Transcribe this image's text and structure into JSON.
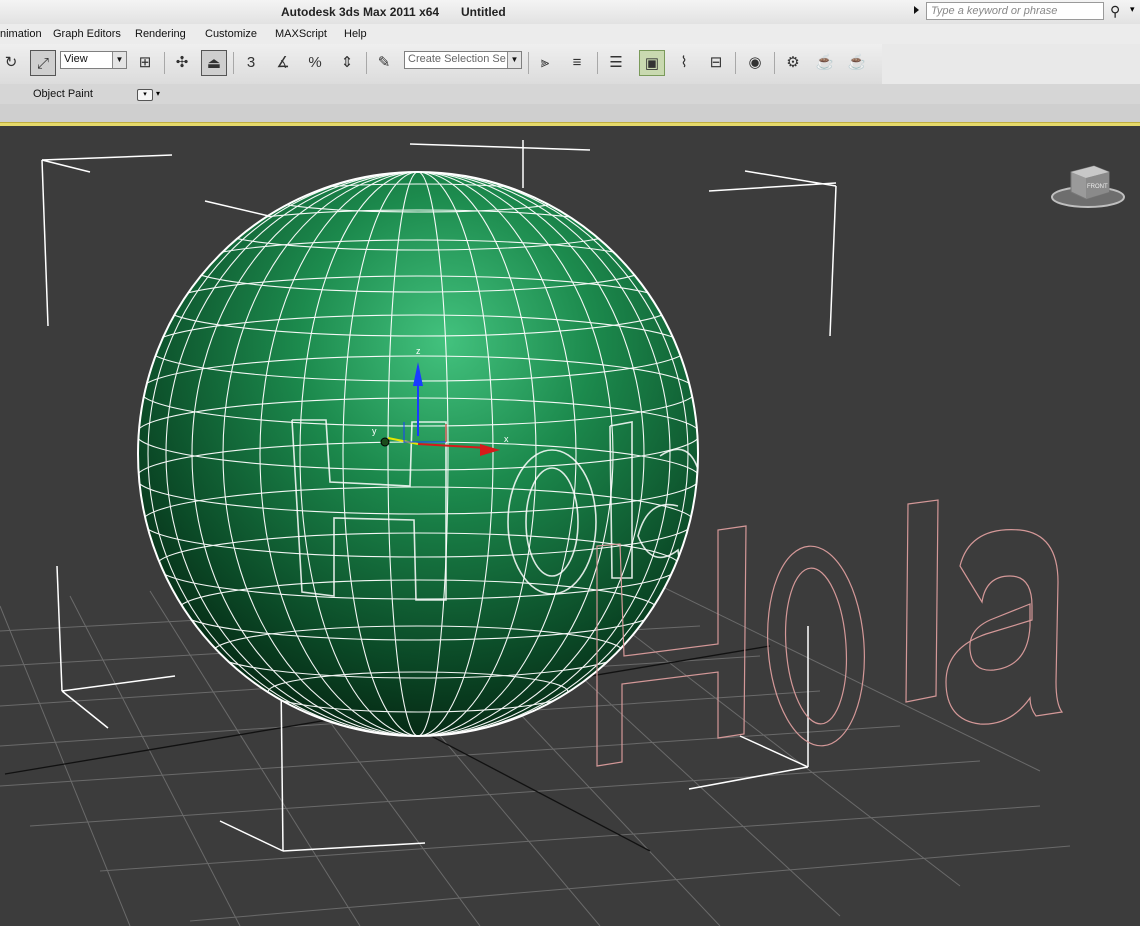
{
  "title_bar": {
    "app_title": "Autodesk 3ds Max  2011 x64",
    "document_title": "Untitled",
    "search_placeholder": "Type a keyword or phrase"
  },
  "menu": {
    "items": [
      "nimation",
      "Graph Editors",
      "Rendering",
      "Customize",
      "MAXScript",
      "Help"
    ]
  },
  "toolbar": {
    "view_select": "View",
    "selection_set_placeholder": "Create Selection Se",
    "snap_value": "3",
    "percent_label": "%"
  },
  "ribbon": {
    "label": "Object Paint"
  },
  "viewport": {
    "axis_labels": {
      "x": "x",
      "y": "y",
      "z": "z"
    },
    "text_object": "Hola",
    "viewcube_label": "FRONT",
    "sphere_color": "#1f8a4e",
    "text_color": "#d79a9a"
  }
}
